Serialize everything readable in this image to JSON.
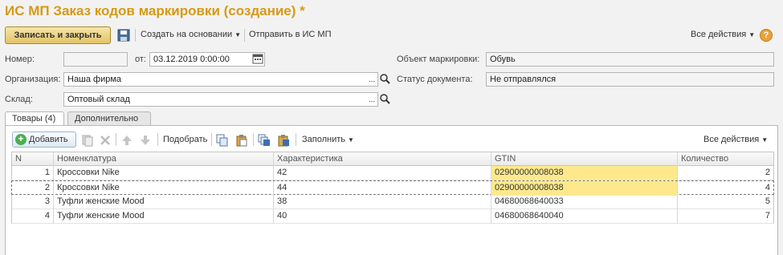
{
  "window": {
    "title": "ИС МП Заказ кодов маркировки (создание) *"
  },
  "toolbar": {
    "save_close": "Записать и закрыть",
    "create_based": "Создать на основании",
    "send": "Отправить в ИС МП",
    "all_actions": "Все действия",
    "help": "?"
  },
  "form": {
    "number_label": "Номер:",
    "number_value": "",
    "from_label": "от:",
    "date_value": "03.12.2019  0:00:00",
    "object_label": "Объект маркировки:",
    "object_value": "Обувь",
    "org_label": "Организация:",
    "org_value": "Наша фирма",
    "status_label": "Статус документа:",
    "status_value": "Не отправлялся",
    "warehouse_label": "Склад:",
    "warehouse_value": "Оптовый склад"
  },
  "tabs": [
    {
      "label": "Товары (4)",
      "active": true
    },
    {
      "label": "Дополнительно",
      "active": false
    }
  ],
  "table_toolbar": {
    "add": "Добавить",
    "pick": "Подобрать",
    "fill": "Заполнить",
    "all_actions": "Все действия"
  },
  "table": {
    "columns": [
      "N",
      "Номенклатура",
      "Характеристика",
      "GTIN",
      "Количество"
    ],
    "rows": [
      {
        "n": "1",
        "item": "Кроссовки Nike",
        "char": "42",
        "gtin": "02900000008038",
        "qty": "2"
      },
      {
        "n": "2",
        "item": "Кроссовки Nike",
        "char": "44",
        "gtin": "02900000008038",
        "qty": "4"
      },
      {
        "n": "3",
        "item": "Туфли женские Mood",
        "char": "38",
        "gtin": "04680068640033",
        "qty": "5"
      },
      {
        "n": "4",
        "item": "Туфли женские Mood",
        "char": "40",
        "gtin": "04680068640040",
        "qty": "7"
      }
    ]
  },
  "colors": {
    "title": "#d69a14",
    "gtin_highlight": "#fde98c",
    "primary_button": "#e3c366"
  }
}
